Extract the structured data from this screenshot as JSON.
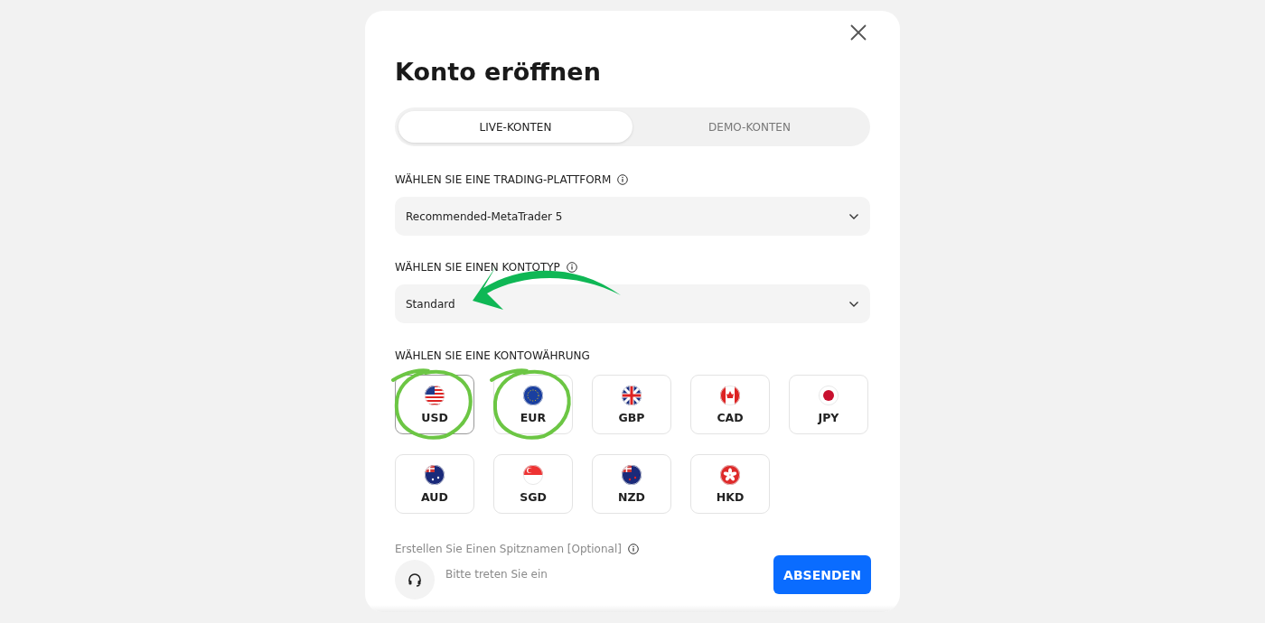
{
  "dialog": {
    "title": "Konto eröffnen"
  },
  "tabs": [
    {
      "label": "LIVE-KONTEN",
      "selected": true
    },
    {
      "label": "DEMO-KONTEN",
      "selected": false
    }
  ],
  "platform": {
    "label": "WÄHLEN SIE EINE TRADING-PLATTFORM",
    "value": "Recommended-MetaTrader 5"
  },
  "account_type": {
    "label": "WÄHLEN SIE EINEN KONTOTYP",
    "value": "Standard",
    "arrow": true
  },
  "currency": {
    "label": "WÄHLEN SIE EINE KONTOWÄHRUNG",
    "options": [
      {
        "code": "USD",
        "selected": true,
        "circled": true
      },
      {
        "code": "EUR",
        "selected": false,
        "circled": true
      },
      {
        "code": "GBP",
        "selected": false,
        "circled": false
      },
      {
        "code": "CAD",
        "selected": false,
        "circled": false
      },
      {
        "code": "JPY",
        "selected": false,
        "circled": false
      },
      {
        "code": "AUD",
        "selected": false,
        "circled": false
      },
      {
        "code": "SGD",
        "selected": false,
        "circled": false
      },
      {
        "code": "NZD",
        "selected": false,
        "circled": false
      },
      {
        "code": "HKD",
        "selected": false,
        "circled": false
      }
    ]
  },
  "nickname": {
    "label": "Erstellen Sie Einen Spitznamen [Optional]",
    "placeholder": "Bitte treten Sie ein"
  },
  "submit": "ABSENDEN"
}
